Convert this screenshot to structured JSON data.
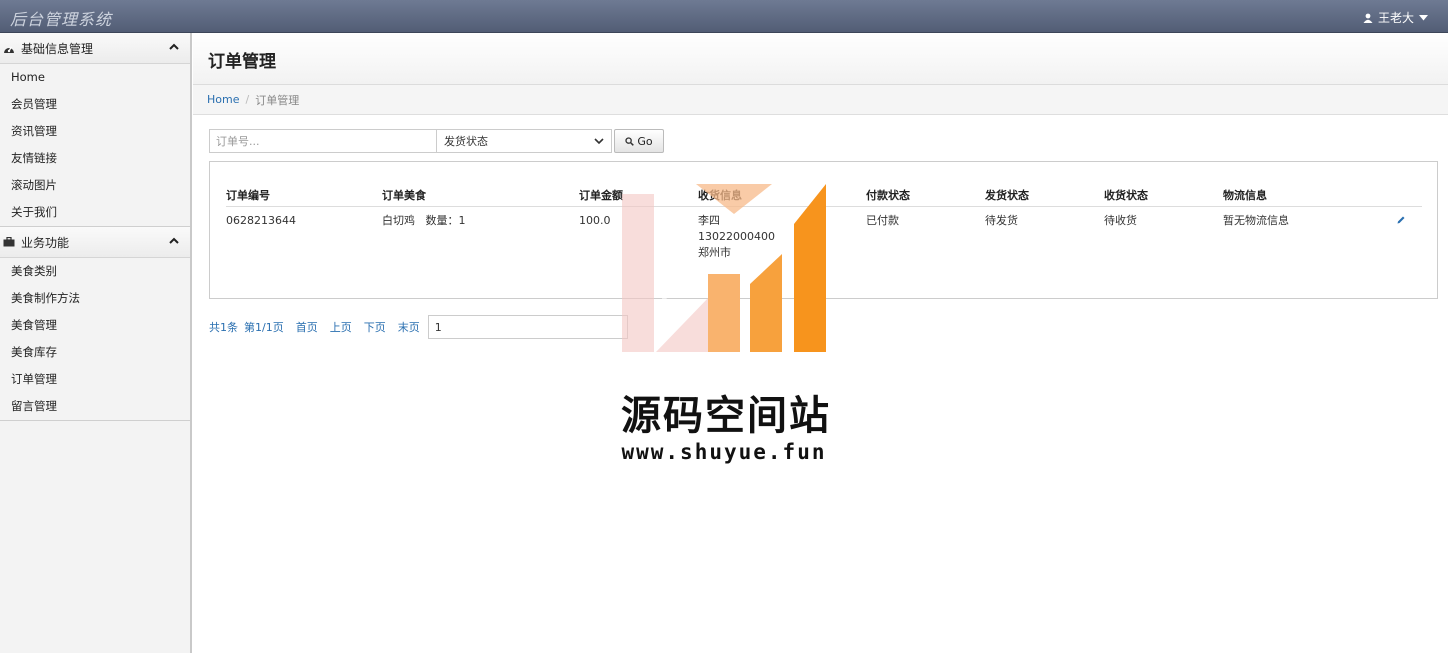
{
  "app": {
    "title": "后台管理系统"
  },
  "user": {
    "name": "王老大"
  },
  "sidebar": {
    "groups": [
      {
        "label": "基础信息管理",
        "icon": "dashboard-icon",
        "items": [
          "Home",
          "会员管理",
          "资讯管理",
          "友情链接",
          "滚动图片",
          "关于我们"
        ]
      },
      {
        "label": "业务功能",
        "icon": "briefcase-icon",
        "items": [
          "美食类别",
          "美食制作方法",
          "美食管理",
          "美食库存",
          "订单管理",
          "留言管理"
        ]
      }
    ]
  },
  "page": {
    "title": "订单管理"
  },
  "breadcrumb": {
    "home": "Home",
    "current": "订单管理"
  },
  "search": {
    "placeholder": "订单号...",
    "status_select": "发货状态",
    "go_label": "Go"
  },
  "table": {
    "headers": [
      "订单编号",
      "订单美食",
      "订单金额",
      "收货信息",
      "付款状态",
      "发货状态",
      "收货状态",
      "物流信息"
    ],
    "rows": [
      {
        "order_no": "0628213644",
        "food": "白切鸡   数量：1",
        "amount": "100.0",
        "recv_name": "李四",
        "recv_phone": "13022000400",
        "recv_city": "郑州市",
        "pay_status": "已付款",
        "ship_status": "待发货",
        "recv_status": "待收货",
        "logistics": "暂无物流信息"
      }
    ]
  },
  "pager": {
    "total": "共1条",
    "page": "第1/1页",
    "first": "首页",
    "prev": "上页",
    "next": "下页",
    "last": "末页",
    "input_value": "1"
  },
  "watermark": {
    "title": "源码空间站",
    "url": "www.shuyue.fun"
  },
  "colors": {
    "navbar": "#5e6981",
    "link": "#2a6fb0",
    "sidebar_bg": "#f3f3f3",
    "logo_orange": "#f7941d"
  }
}
